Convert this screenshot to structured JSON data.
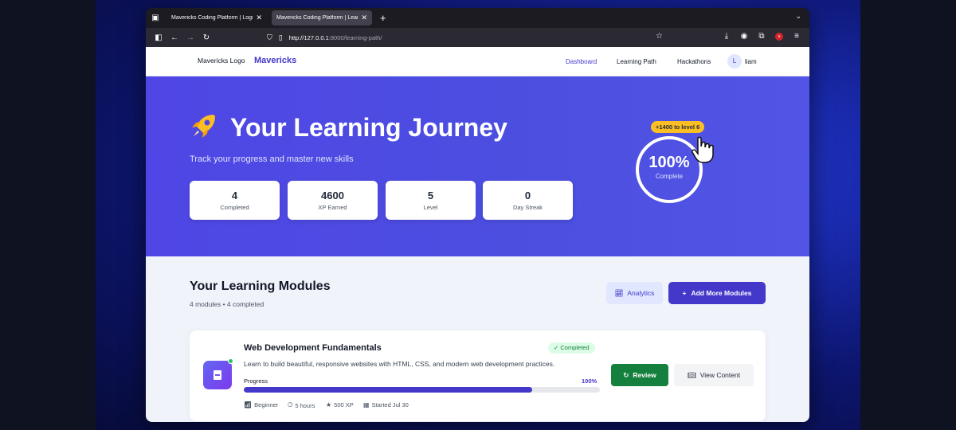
{
  "browser": {
    "tabs": [
      {
        "label": "Mavericks Coding Platform | Login - M",
        "active": false
      },
      {
        "label": "Mavericks Coding Platform | Learning P",
        "active": true
      }
    ],
    "url_host": "http://127.0.0.1",
    "url_rest": ":8000/learning-path/"
  },
  "header": {
    "logo_alt": "Mavericks Logo",
    "logo_text": "Mavericks",
    "nav": [
      "Dashboard",
      "Learning Path",
      "Hackathons"
    ],
    "avatar_initial": "L",
    "user_name": "liam"
  },
  "hero": {
    "title": "Your Learning Journey",
    "subtitle": "Track your progress and master new skills",
    "stats": [
      {
        "value": "4",
        "label": "Completed"
      },
      {
        "value": "4600",
        "label": "XP Earned"
      },
      {
        "value": "5",
        "label": "Level"
      },
      {
        "value": "0",
        "label": "Day Streak"
      }
    ],
    "level_badge": "+1400 to level 6",
    "completion_pct": "100%",
    "completion_label": "Complete",
    "completion_fraction": 1.0
  },
  "modules_section": {
    "title": "Your Learning Modules",
    "subtitle": "4 modules • 4 completed",
    "analytics_label": "Analytics",
    "add_label": "Add More Modules"
  },
  "module": {
    "title": "Web Development Fundamentals",
    "status": "✓ Completed",
    "description": "Learn to build beautiful, responsive websites with HTML, CSS, and modern web development practices.",
    "progress_label": "Progress",
    "progress_value": "100%",
    "progress_fraction": 0.81,
    "meta": {
      "level": "Beginner",
      "duration": "5 hours",
      "xp": "500 XP",
      "started": "Started Jul 30"
    },
    "review_label": "Review",
    "view_label": "View Content"
  },
  "colors": {
    "accent": "#4338ca",
    "hero_bg": "#4f46e5",
    "success": "#15803d",
    "badge": "#fbbf24"
  }
}
